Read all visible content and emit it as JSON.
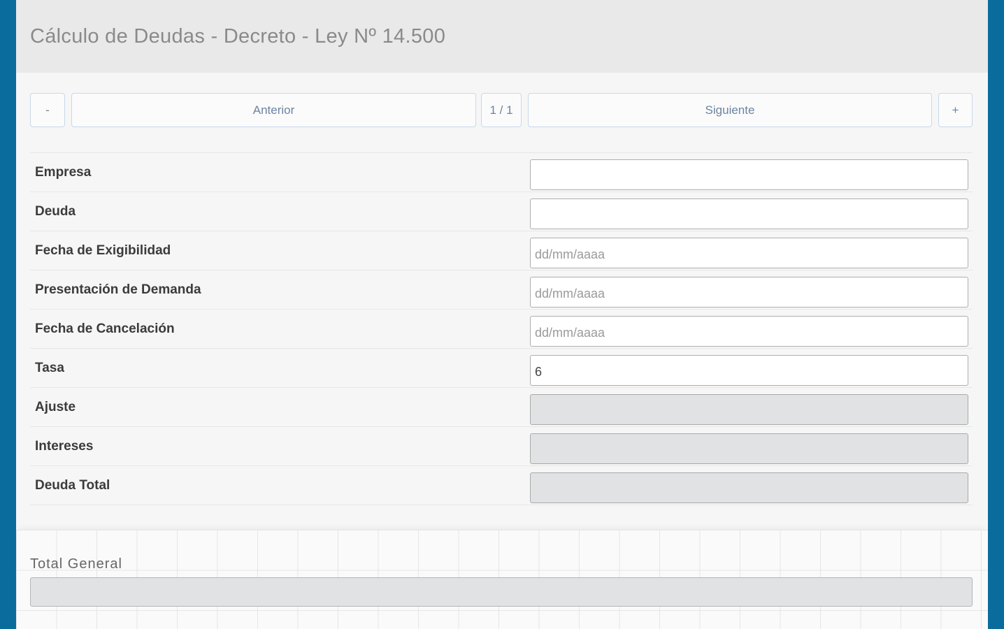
{
  "header": {
    "title": "Cálculo de Deudas - Decreto - Ley Nº 14.500"
  },
  "pager": {
    "minus_label": "-",
    "prev_label": "Anterior",
    "page_indicator": "1 / 1",
    "next_label": "Siguiente",
    "plus_label": "+"
  },
  "form": {
    "rows": [
      {
        "label": "Empresa",
        "value": "",
        "placeholder": ""
      },
      {
        "label": "Deuda",
        "value": "",
        "placeholder": ""
      },
      {
        "label": "Fecha de Exigibilidad",
        "value": "",
        "placeholder": "dd/mm/aaaa"
      },
      {
        "label": "Presentación de Demanda",
        "value": "",
        "placeholder": "dd/mm/aaaa"
      },
      {
        "label": "Fecha de Cancelación",
        "value": "",
        "placeholder": "dd/mm/aaaa"
      },
      {
        "label": "Tasa",
        "value": "6",
        "placeholder": ""
      },
      {
        "label": "Ajuste",
        "value": "",
        "placeholder": ""
      },
      {
        "label": "Intereses",
        "value": "",
        "placeholder": ""
      },
      {
        "label": "Deuda Total",
        "value": "",
        "placeholder": ""
      }
    ]
  },
  "total": {
    "label": "Total General",
    "value": ""
  },
  "colors": {
    "frame": "#0a6c9c",
    "header_bg": "#e9e9e9",
    "button_border": "#c7d8ec",
    "button_text": "#6b84a1",
    "readonly_bg": "#e0e2e4"
  }
}
